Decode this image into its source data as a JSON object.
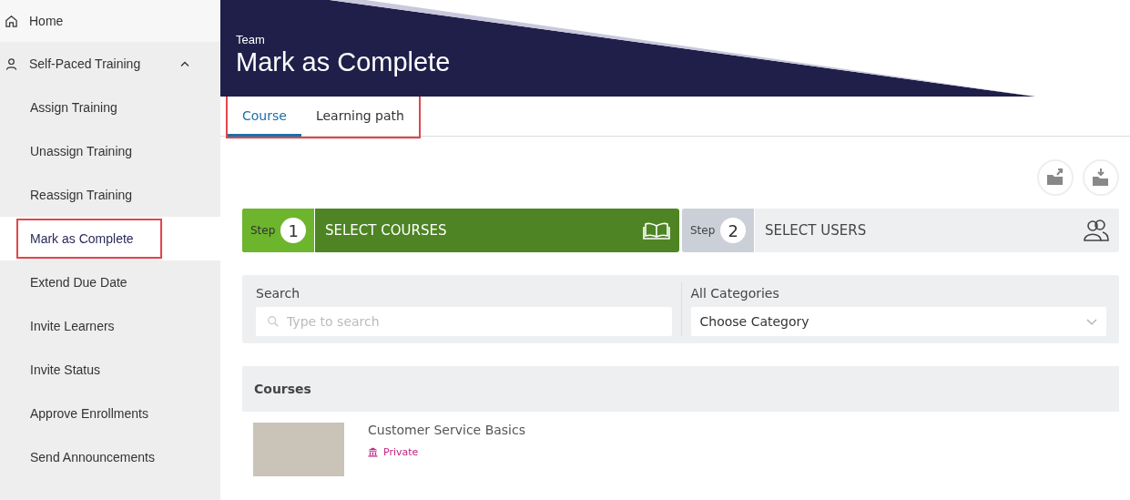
{
  "sidebar": {
    "items": [
      {
        "label": "Home",
        "selected": false
      },
      {
        "label": "Self-Paced Training",
        "selected": false,
        "expanded": true,
        "children": [
          {
            "label": "Assign Training",
            "selected": false,
            "highlighted": false
          },
          {
            "label": "Unassign Training",
            "selected": false,
            "highlighted": false
          },
          {
            "label": "Reassign Training",
            "selected": false,
            "highlighted": false
          },
          {
            "label": "Mark as Complete",
            "selected": true,
            "highlighted": true
          },
          {
            "label": "Extend Due Date",
            "selected": false,
            "highlighted": false
          },
          {
            "label": "Invite Learners",
            "selected": false,
            "highlighted": false
          },
          {
            "label": "Invite Status",
            "selected": false,
            "highlighted": false
          },
          {
            "label": "Approve Enrollments",
            "selected": false,
            "highlighted": false
          },
          {
            "label": "Send Announcements",
            "selected": false,
            "highlighted": false
          }
        ]
      }
    ]
  },
  "header": {
    "subtitle": "Team",
    "title": "Mark as Complete"
  },
  "tabs": {
    "highlighted": true,
    "items": [
      {
        "label": "Course",
        "selected": true
      },
      {
        "label": "Learning path",
        "selected": false
      }
    ]
  },
  "steps": [
    {
      "step_label": "Step",
      "number": "1",
      "title": "SELECT COURSES",
      "selected": true
    },
    {
      "step_label": "Step",
      "number": "2",
      "title": "SELECT USERS",
      "selected": false
    }
  ],
  "filters": {
    "search": {
      "label": "Search",
      "placeholder": "Type to search"
    },
    "category": {
      "label": "All Categories",
      "value": "Choose Category"
    }
  },
  "courses": {
    "title": "Courses",
    "items": [
      {
        "name": "Customer Service Basics",
        "visibility": "Private"
      }
    ]
  }
}
